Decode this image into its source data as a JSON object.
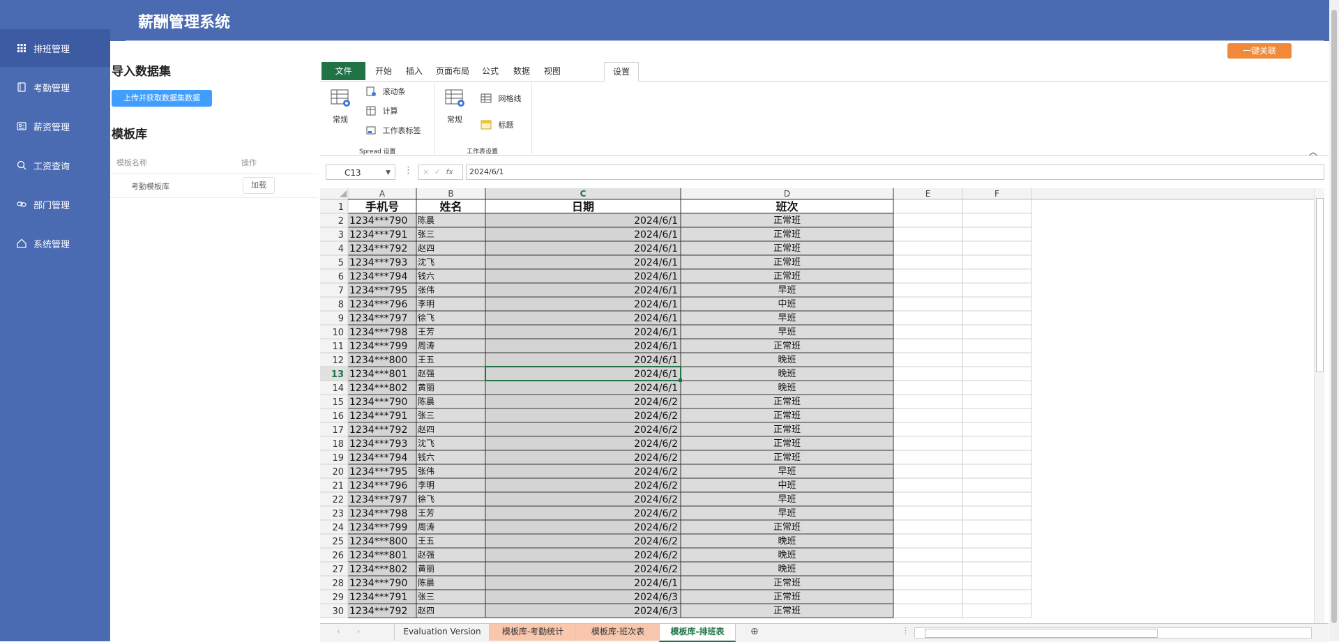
{
  "app": {
    "title": "薪酬管理系统",
    "link_button": "一键关联"
  },
  "sidebar": {
    "items": [
      {
        "label": "排班管理",
        "icon": "grid-icon"
      },
      {
        "label": "考勤管理",
        "icon": "book-icon"
      },
      {
        "label": "薪资管理",
        "icon": "id-card-icon"
      },
      {
        "label": "工资查询",
        "icon": "search-icon"
      },
      {
        "label": "部门管理",
        "icon": "link-icon"
      },
      {
        "label": "系统管理",
        "icon": "home-icon"
      }
    ]
  },
  "panel": {
    "import_title": "导入数据集",
    "upload_button": "上传并获取数据集数据",
    "library_title": "模板库",
    "columns": [
      "模板名称",
      "操作"
    ],
    "rows": [
      {
        "name": "考勤模板库",
        "action": "加载"
      }
    ]
  },
  "ribbon": {
    "tabs": [
      "文件",
      "开始",
      "插入",
      "页面布局",
      "公式",
      "数据",
      "视图",
      "设置"
    ],
    "spread_group": {
      "big": "常规",
      "items": [
        "滚动条",
        "计算",
        "工作表标签"
      ],
      "label": "Spread 设置"
    },
    "sheet_group": {
      "big": "常规",
      "items": [
        "网格线",
        "标题"
      ],
      "label": "工作表设置"
    }
  },
  "formula_bar": {
    "cell_ref": "C13",
    "cancel": "×",
    "confirm": "✓",
    "fx": "fx",
    "value": "2024/6/1"
  },
  "sheet": {
    "columns": [
      "A",
      "B",
      "C",
      "D",
      "E",
      "F"
    ],
    "headers": [
      "手机号",
      "姓名",
      "日期",
      "班次"
    ],
    "active_row": 13,
    "rows": [
      [
        "1234***790",
        "陈晨",
        "2024/6/1",
        "正常班"
      ],
      [
        "1234***791",
        "张三",
        "2024/6/1",
        "正常班"
      ],
      [
        "1234***792",
        "赵四",
        "2024/6/1",
        "正常班"
      ],
      [
        "1234***793",
        "沈飞",
        "2024/6/1",
        "正常班"
      ],
      [
        "1234***794",
        "钱六",
        "2024/6/1",
        "正常班"
      ],
      [
        "1234***795",
        "张伟",
        "2024/6/1",
        "早班"
      ],
      [
        "1234***796",
        "李明",
        "2024/6/1",
        "中班"
      ],
      [
        "1234***797",
        "徐飞",
        "2024/6/1",
        "早班"
      ],
      [
        "1234***798",
        "王芳",
        "2024/6/1",
        "早班"
      ],
      [
        "1234***799",
        "周涛",
        "2024/6/1",
        "正常班"
      ],
      [
        "1234***800",
        "王五",
        "2024/6/1",
        "晚班"
      ],
      [
        "1234***801",
        "赵强",
        "2024/6/1",
        "晚班"
      ],
      [
        "1234***802",
        "黄丽",
        "2024/6/1",
        "晚班"
      ],
      [
        "1234***790",
        "陈晨",
        "2024/6/2",
        "正常班"
      ],
      [
        "1234***791",
        "张三",
        "2024/6/2",
        "正常班"
      ],
      [
        "1234***792",
        "赵四",
        "2024/6/2",
        "正常班"
      ],
      [
        "1234***793",
        "沈飞",
        "2024/6/2",
        "正常班"
      ],
      [
        "1234***794",
        "钱六",
        "2024/6/2",
        "正常班"
      ],
      [
        "1234***795",
        "张伟",
        "2024/6/2",
        "早班"
      ],
      [
        "1234***796",
        "李明",
        "2024/6/2",
        "中班"
      ],
      [
        "1234***797",
        "徐飞",
        "2024/6/2",
        "早班"
      ],
      [
        "1234***798",
        "王芳",
        "2024/6/2",
        "早班"
      ],
      [
        "1234***799",
        "周涛",
        "2024/6/2",
        "正常班"
      ],
      [
        "1234***800",
        "王五",
        "2024/6/2",
        "晚班"
      ],
      [
        "1234***801",
        "赵强",
        "2024/6/2",
        "晚班"
      ],
      [
        "1234***802",
        "黄丽",
        "2024/6/2",
        "晚班"
      ],
      [
        "1234***790",
        "陈晨",
        "2024/6/1",
        "正常班"
      ],
      [
        "1234***791",
        "张三",
        "2024/6/3",
        "正常班"
      ],
      [
        "1234***792",
        "赵四",
        "2024/6/3",
        "正常班"
      ]
    ]
  },
  "sheet_tabs": [
    "Evaluation Version",
    "模板库-考勤统计",
    "模板库-班次表",
    "模板库-排班表"
  ],
  "colors": {
    "sidebar": "#4a6ab2",
    "accent_green": "#217346",
    "orange": "#f08a3a",
    "blue": "#409eff",
    "tab_salmon": "#f8c7ad"
  }
}
